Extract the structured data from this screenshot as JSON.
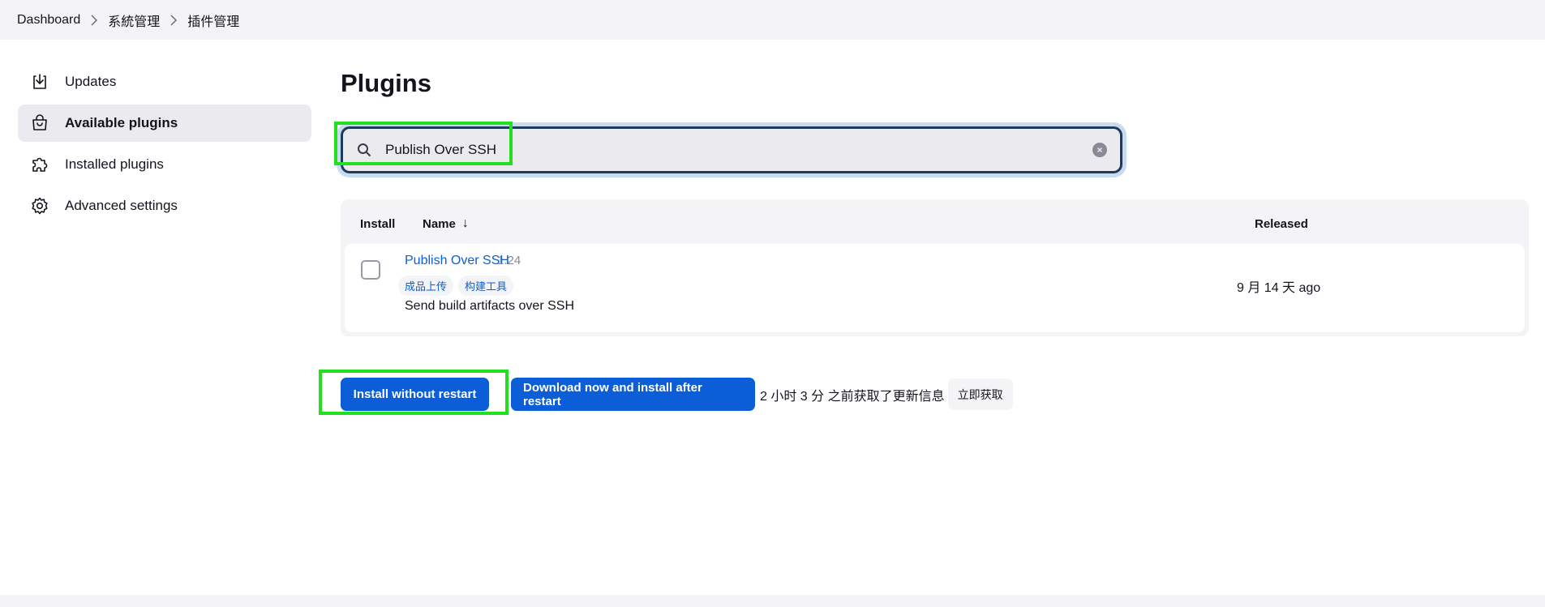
{
  "breadcrumb": {
    "items": [
      "Dashboard",
      "系統管理",
      "插件管理"
    ]
  },
  "sidebar": {
    "items": [
      {
        "label": "Updates",
        "icon": "download-icon",
        "active": false
      },
      {
        "label": "Available plugins",
        "icon": "shopping-bag-icon",
        "active": true
      },
      {
        "label": "Installed plugins",
        "icon": "puzzle-icon",
        "active": false
      },
      {
        "label": "Advanced settings",
        "icon": "gear-icon",
        "active": false
      }
    ]
  },
  "main": {
    "title": "Plugins",
    "search": {
      "value": "Publish Over SSH",
      "placeholder": ""
    },
    "table": {
      "headers": {
        "install": "Install",
        "name": "Name",
        "name_sort": "↓",
        "released": "Released"
      },
      "rows": [
        {
          "name": "Publish Over SSH",
          "version": "1.24",
          "tags": [
            "成品上传",
            "构建工具"
          ],
          "description": "Send build artifacts over SSH",
          "released": "9 月 14 天 ago",
          "checked": false
        }
      ]
    },
    "actions": {
      "install_label": "Install without restart",
      "download_label": "Download now and install after restart",
      "info_text": "2 小时 3 分 之前获取了更新信息",
      "refresh_label": "立即获取"
    }
  },
  "colors": {
    "accent": "#0b5ed7",
    "highlight": "#22e01f",
    "search_border": "#1d3c5c"
  }
}
